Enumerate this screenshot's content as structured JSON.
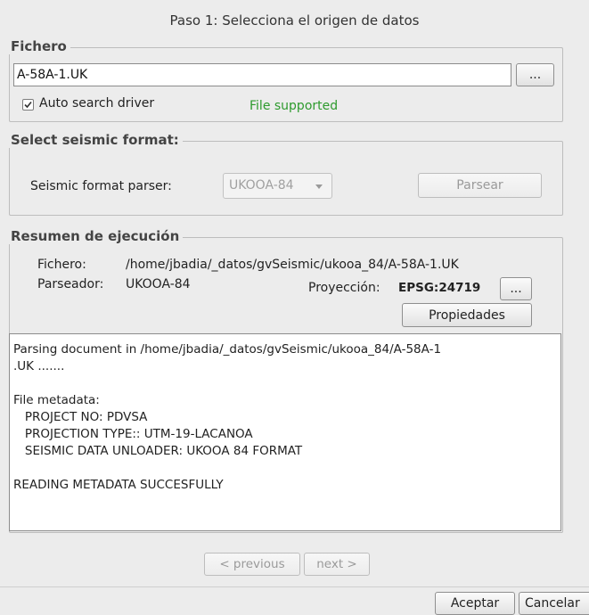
{
  "wizard": {
    "step_title": "Paso 1: Selecciona el origen de datos"
  },
  "fichero_group": {
    "legend": "Fichero",
    "file_value": "A-58A-1.UK",
    "browse_label": "...",
    "auto_search_label": "Auto search driver",
    "auto_search_checked": true,
    "status_text": "File supported",
    "status_color": "#2d9a2d"
  },
  "seismic_group": {
    "legend": "Select seismic format:",
    "parser_label": "Seismic format parser:",
    "parser_selected": "UKOOA-84",
    "parse_button": "Parsear"
  },
  "summary_group": {
    "legend": "Resumen de ejecución",
    "fichero_label": "Fichero:",
    "fichero_value": "/home/jbadia/_datos/gvSeismic/ukooa_84/A-58A-1.UK",
    "parser_label": "Parseador:",
    "parser_value": "UKOOA-84",
    "projection_label": "Proyección:",
    "projection_value": "EPSG:24719",
    "projection_button": "...",
    "properties_button": "Propiedades",
    "log_text": "Parsing document in /home/jbadia/_datos/gvSeismic/ukooa_84/A-58A-1\n.UK .......\n\nFile metadata:\n   PROJECT NO: PDVSA\n   PROJECTION TYPE:: UTM-19-LACANOA\n   SEISMIC DATA UNLOADER: UKOOA 84 FORMAT\n\nREADING METADATA SUCCESFULLY"
  },
  "navigation": {
    "previous": "< previous",
    "next": "next >"
  },
  "dialog_buttons": {
    "accept": "Aceptar",
    "cancel": "Cancelar"
  }
}
